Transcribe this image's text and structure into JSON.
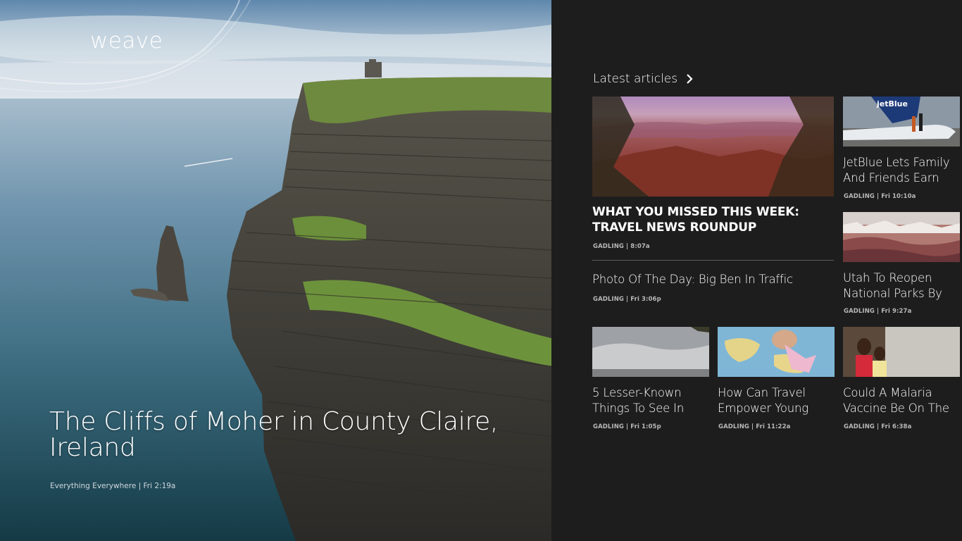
{
  "app": {
    "name": "weave"
  },
  "hero": {
    "title": "The Cliffs of Moher in County Claire, Ireland",
    "source": "Everything Everywhere",
    "time": "Fri 2:19a"
  },
  "section": {
    "title": "Latest articles",
    "icon": "chevron-right-icon"
  },
  "feature": {
    "title": "WHAT YOU MISSED THIS WEEK: TRAVEL NEWS ROUNDUP",
    "meta": "GADLING | 8:07a"
  },
  "text_article": {
    "title": "Photo Of The Day: Big Ben In Traffic",
    "meta": "GADLING | Fri 3:06p"
  },
  "side_articles": [
    {
      "title_line1": "JetBlue Lets Family",
      "title_line2": "And Friends Earn",
      "meta": "GADLING | Fri 10:10a"
    },
    {
      "title_line1": "Utah To Reopen",
      "title_line2": "National Parks By",
      "meta": "GADLING | Fri 9:27a"
    }
  ],
  "bottom_articles": [
    {
      "title_line1": "5 Lesser-Known",
      "title_line2": "Things To See In",
      "meta": "GADLING | Fri 1:05p"
    },
    {
      "title_line1": "How Can Travel",
      "title_line2": "Empower Young",
      "meta": "GADLING | Fri 11:22a"
    },
    {
      "title_line1": "Could A Malaria",
      "title_line2": "Vaccine Be On The",
      "meta": "GADLING | Fri 6:38a"
    }
  ],
  "colors": {
    "panel_bg": "#1d1d1d",
    "text": "#ffffff",
    "meta": "#b8b8b8"
  }
}
